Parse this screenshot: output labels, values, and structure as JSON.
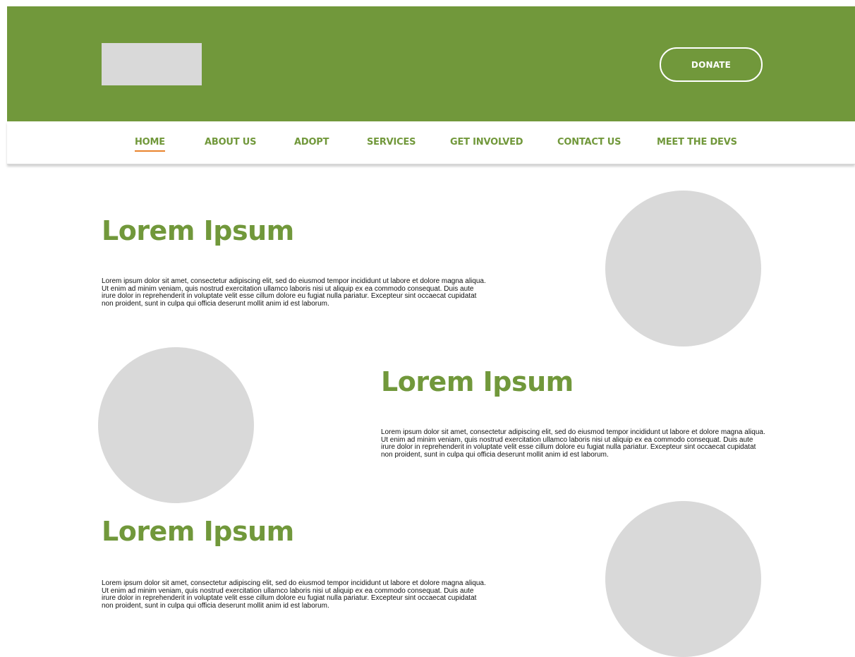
{
  "header": {
    "donate_label": "DONATE",
    "background_color": "#71983b"
  },
  "nav": {
    "items": [
      {
        "label": "HOME",
        "active": true
      },
      {
        "label": "ABOUT US",
        "active": false
      },
      {
        "label": "ADOPT",
        "active": false
      },
      {
        "label": "SERVICES",
        "active": false
      },
      {
        "label": "GET INVOLVED",
        "active": false
      },
      {
        "label": "CONTACT US",
        "active": false
      },
      {
        "label": "MEET THE DEVS",
        "active": false
      }
    ],
    "active_underline_color": "#e9842d",
    "text_color": "#71983b"
  },
  "sections": [
    {
      "heading": "Lorem Ipsum",
      "body": "Lorem ipsum dolor sit amet, consectetur adipiscing elit, sed do eiusmod tempor incididunt ut labore et dolore magna aliqua. Ut enim ad minim veniam, quis nostrud exercitation ullamco laboris nisi ut aliquip ex ea commodo consequat. Duis aute irure dolor in reprehenderit in voluptate velit esse cillum dolore eu fugiat nulla pariatur. Excepteur sint occaecat cupidatat non proident, sunt in culpa qui officia deserunt mollit anim id est laborum."
    },
    {
      "heading": "Lorem Ipsum",
      "body": "Lorem ipsum dolor sit amet, consectetur adipiscing elit, sed do eiusmod tempor incididunt ut labore et dolore magna aliqua. Ut enim ad minim veniam, quis nostrud exercitation ullamco laboris nisi ut aliquip ex ea commodo consequat. Duis aute irure dolor in reprehenderit in voluptate velit esse cillum dolore eu fugiat nulla pariatur. Excepteur sint occaecat cupidatat non proident, sunt in culpa qui officia deserunt mollit anim id est laborum."
    },
    {
      "heading": "Lorem Ipsum",
      "body": "Lorem ipsum dolor sit amet, consectetur adipiscing elit, sed do eiusmod tempor incididunt ut labore et dolore magna aliqua. Ut enim ad minim veniam, quis nostrud exercitation ullamco laboris nisi ut aliquip ex ea commodo consequat. Duis aute irure dolor in reprehenderit in voluptate velit esse cillum dolore eu fugiat nulla pariatur. Excepteur sint occaecat cupidatat non proident, sunt in culpa qui officia deserunt mollit anim id est laborum."
    }
  ],
  "colors": {
    "accent_green": "#71983b",
    "placeholder_gray": "#d9d9d9"
  }
}
